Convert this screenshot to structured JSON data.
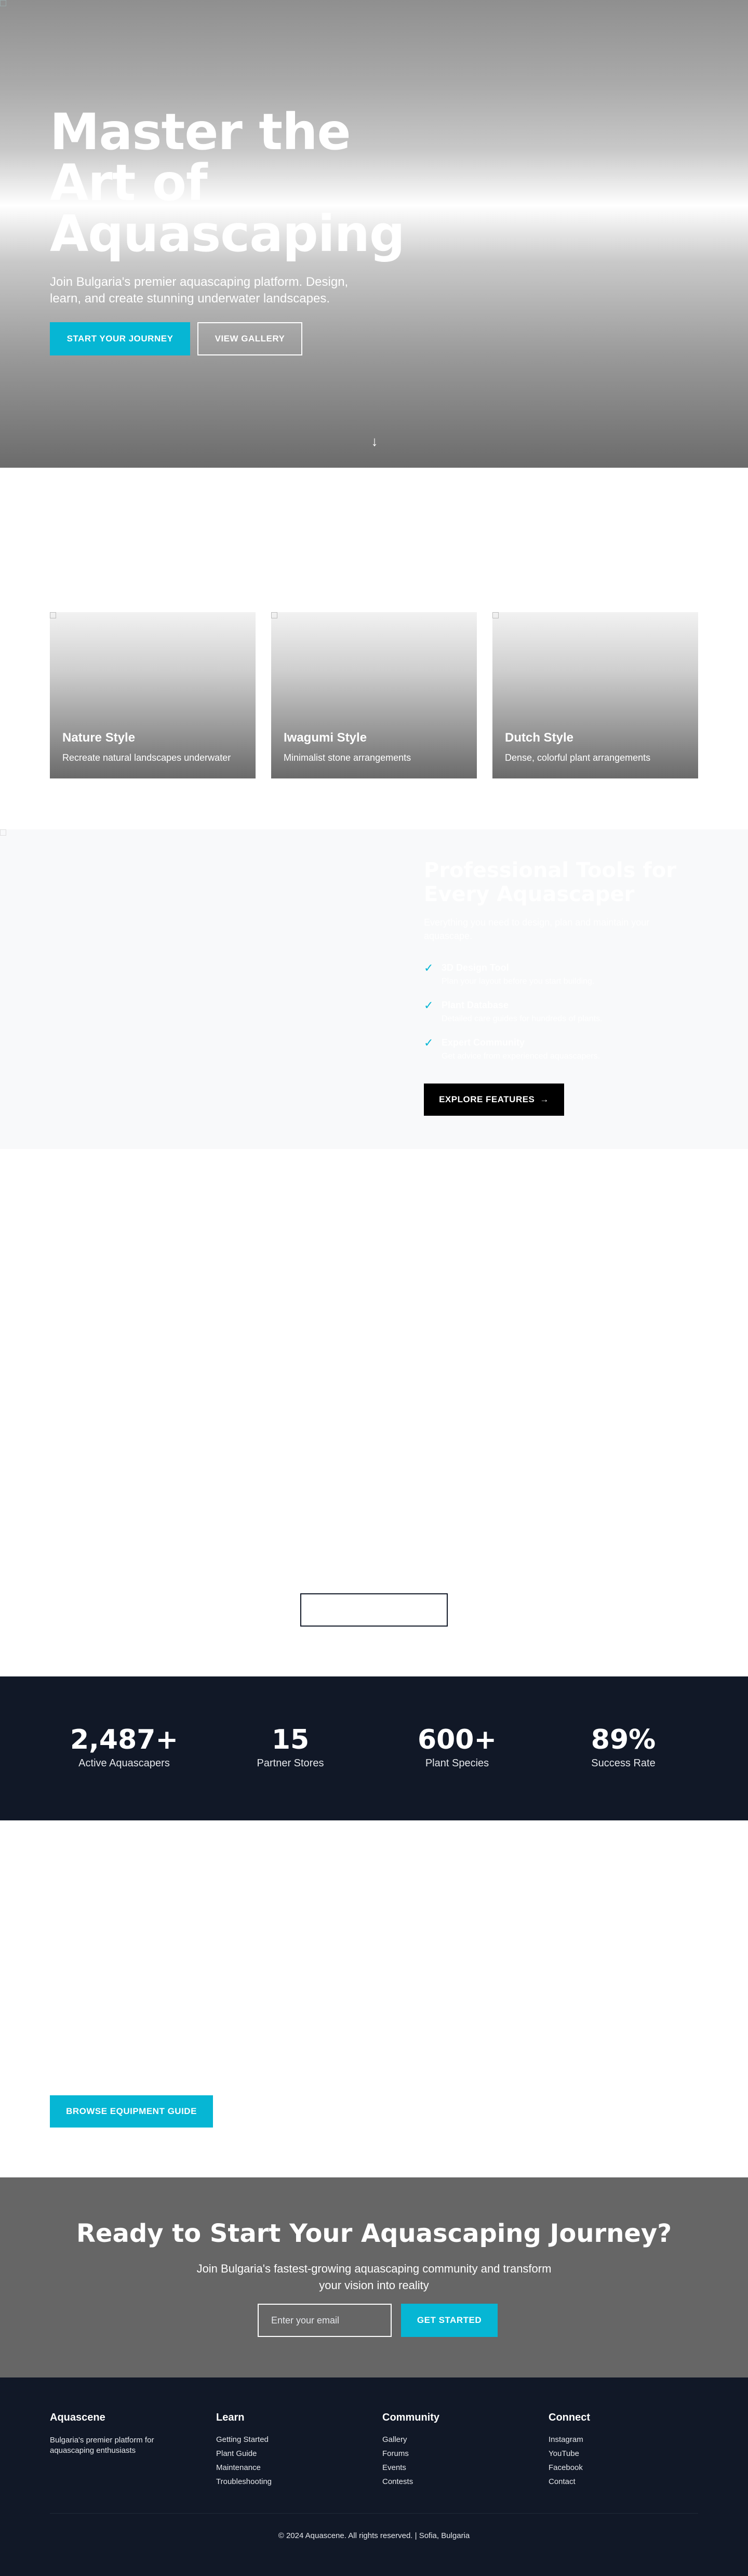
{
  "hero": {
    "image_alt": "",
    "title": "Master the Art of Aquascaping",
    "subtitle": "Join Bulgaria's premier aquascaping platform. Design, learn, and create stunning underwater landscapes.",
    "primary_button": "START YOUR JOURNEY",
    "secondary_button": "VIEW GALLERY",
    "scroll_icon": "arrow-down-icon"
  },
  "styles": {
    "cards": [
      {
        "title": "Nature Style",
        "desc": "Recreate natural landscapes underwater"
      },
      {
        "title": "Iwagumi Style",
        "desc": "Minimalist stone arrangements"
      },
      {
        "title": "Dutch Style",
        "desc": "Dense, colorful plant arrangements"
      }
    ]
  },
  "features": {
    "title": "Professional Tools for Every Aquascaper",
    "subtitle": "Everything you need to design, plan and maintain your aquascape.",
    "items": [
      {
        "title": "3D Design Tool",
        "desc": "Plan your layout before you start building."
      },
      {
        "title": "Plant Database",
        "desc": "Detailed care guides for hundreds of plants."
      },
      {
        "title": "Expert Community",
        "desc": "Get advice from experienced aquascapers."
      }
    ],
    "button": "EXPLORE FEATURES",
    "button_icon": "arrow-right-icon"
  },
  "stats": [
    {
      "value": "2,487+",
      "label": "Active Aquascapers"
    },
    {
      "value": "15",
      "label": "Partner Stores"
    },
    {
      "value": "600+",
      "label": "Plant Species"
    },
    {
      "value": "89%",
      "label": "Success Rate"
    }
  ],
  "equipment": {
    "button": "BROWSE EQUIPMENT GUIDE"
  },
  "cta": {
    "title": "Ready to Start Your Aquascaping Journey?",
    "subtitle": "Join Bulgaria's fastest-growing aquascaping community and transform your vision into reality",
    "email_placeholder": "Enter your email",
    "button": "GET STARTED"
  },
  "footer": {
    "brand": "Aquascene",
    "tagline": "Bulgaria's premier platform for aquascaping enthusiasts",
    "columns": [
      {
        "title": "Learn",
        "links": [
          "Getting Started",
          "Plant Guide",
          "Maintenance",
          "Troubleshooting"
        ]
      },
      {
        "title": "Community",
        "links": [
          "Gallery",
          "Forums",
          "Events",
          "Contests"
        ]
      },
      {
        "title": "Connect",
        "links": [
          "Instagram",
          "YouTube",
          "Facebook",
          "Contact"
        ]
      }
    ],
    "copyright": "© 2024 Aquascene. All rights reserved. | Sofia, Bulgaria"
  },
  "colors": {
    "accent": "#06b6d4",
    "dark": "#111827",
    "cta_bg": "#666666",
    "features_bg": "#f8f9fa"
  }
}
